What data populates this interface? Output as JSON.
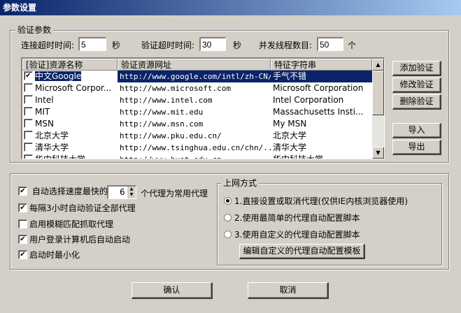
{
  "window": {
    "title": "参数设置"
  },
  "verify": {
    "group_title": "验证参数",
    "connect_timeout_label": "连接超时时间:",
    "connect_timeout_value": "5",
    "connect_unit": "秒",
    "verify_timeout_label": "验证超时时间:",
    "verify_timeout_value": "30",
    "verify_unit": "秒",
    "threads_label": "并发线程数目:",
    "threads_value": "50",
    "threads_unit": "个"
  },
  "table": {
    "columns": [
      "[验证]资源名称",
      "验证资源网址",
      "特征字符串"
    ],
    "rows": [
      {
        "checked": true,
        "name": "中文Google",
        "url": "http://www.google.com/intl/zh-CN/",
        "feature": "手气不错"
      },
      {
        "checked": false,
        "name": "Microsoft Corpor...",
        "url": "http://www.microsoft.com",
        "feature": "Microsoft Corporation"
      },
      {
        "checked": false,
        "name": "Intel",
        "url": "http://www.intel.com",
        "feature": "Intel Corporation"
      },
      {
        "checked": false,
        "name": "MIT",
        "url": "http://www.mit.edu",
        "feature": "Massachusetts Insti..."
      },
      {
        "checked": false,
        "name": "MSN",
        "url": "http://www.msn.com",
        "feature": "My MSN"
      },
      {
        "checked": false,
        "name": "北京大学",
        "url": "http://www.pku.edu.cn/",
        "feature": "北京大学"
      },
      {
        "checked": false,
        "name": "清华大学",
        "url": "http://www.tsinghua.edu.cn/chn/...",
        "feature": "清华大学"
      },
      {
        "checked": false,
        "name": "华中科技大学",
        "url": "http://www.hust.edu.cn",
        "feature": "华中科技大学"
      }
    ]
  },
  "side_buttons": {
    "add": "添加验证",
    "edit": "修改验证",
    "delete": "删除验证",
    "import": "导入",
    "export": "导出"
  },
  "options": {
    "auto_select_prefix": "自动选择速度最快的",
    "auto_select_count": "6",
    "auto_select_suffix": "个代理为常用代理",
    "items": [
      {
        "label": "每隔3小时自动验证全部代理",
        "checked": true
      },
      {
        "label": "启用模糊匹配抓取代理",
        "checked": false
      },
      {
        "label": "用户登录计算机后自动启动",
        "checked": true
      },
      {
        "label": "启动时最小化",
        "checked": true
      }
    ],
    "auto_select_checked": true
  },
  "network": {
    "group_title": "上网方式",
    "radios": [
      {
        "label": "1.直接设置或取消代理(仅供IE内核浏览器使用)",
        "selected": true
      },
      {
        "label": "2.使用最简单的代理自动配置脚本",
        "selected": false
      },
      {
        "label": "3.使用自定义的代理自动配置脚本",
        "selected": false
      }
    ],
    "edit_template_button": "编辑自定义的代理自动配置模板"
  },
  "footer": {
    "ok": "确认",
    "cancel": "取消"
  }
}
